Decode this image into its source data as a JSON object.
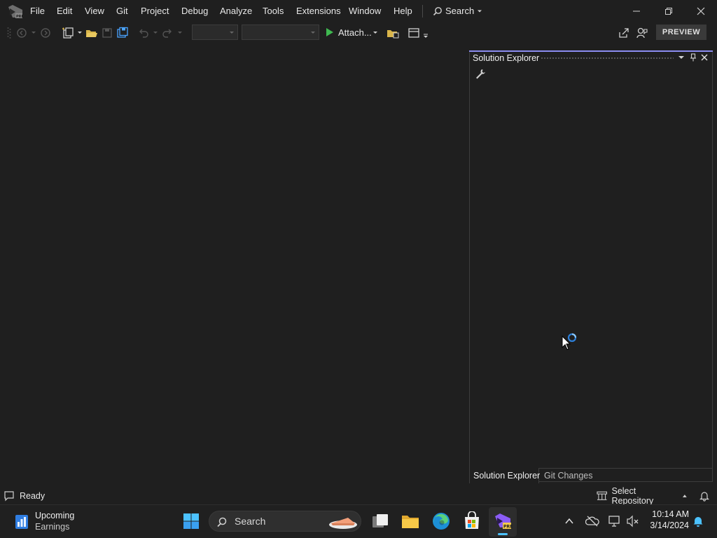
{
  "menu": {
    "items": [
      "File",
      "Edit",
      "View",
      "Git",
      "Project",
      "Debug",
      "Analyze",
      "Tools",
      "Extensions",
      "Window",
      "Help"
    ],
    "search_label": "Search"
  },
  "toolbar": {
    "attach_label": "Attach...",
    "preview_label": "PREVIEW"
  },
  "solution_explorer": {
    "title": "Solution Explorer",
    "tabs": [
      "Solution Explorer",
      "Git Changes"
    ]
  },
  "statusbar": {
    "status": "Ready",
    "repo_label": "Select Repository"
  },
  "taskbar": {
    "widget_title": "Upcoming",
    "widget_subtitle": "Earnings",
    "search_label": "Search",
    "time": "10:14 AM",
    "date": "3/14/2024"
  },
  "colors": {
    "accent": "#8b8cf0",
    "background": "#1f1f1f",
    "run_green": "#3fb950",
    "blue": "#4aa3ff"
  }
}
